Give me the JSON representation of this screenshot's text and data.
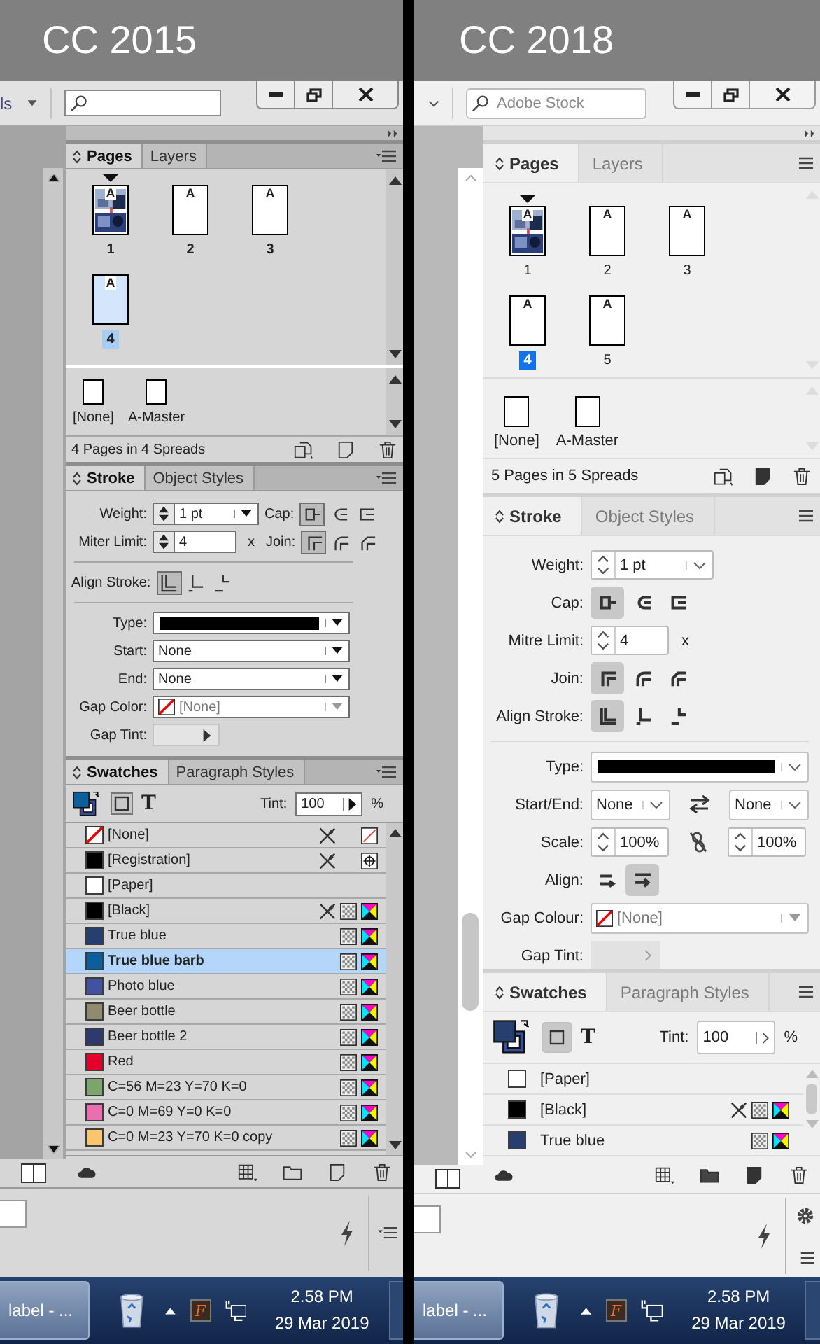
{
  "panes": [
    {
      "kind": "dark",
      "heading": "CC 2015",
      "toolbar": {
        "menu_text": "ls"
      },
      "pages_panel": {
        "tabs": [
          {
            "label": "Pages",
            "selected": true
          },
          {
            "label": "Layers",
            "selected": false
          }
        ],
        "pages": [
          {
            "number": "1",
            "master": "A",
            "kind": "picture",
            "selected": false,
            "current": true
          },
          {
            "number": "2",
            "master": "A",
            "kind": "blank",
            "selected": false,
            "current": false
          },
          {
            "number": "3",
            "master": "A",
            "kind": "blank",
            "selected": false,
            "current": false
          },
          {
            "number": "4",
            "master": "A",
            "kind": "blank",
            "selected": true,
            "current": false
          }
        ],
        "masters": [
          "[None]",
          "A-Master"
        ],
        "status": "4 Pages in 4 Spreads"
      },
      "stroke_panel": {
        "tabs": [
          {
            "label": "Stroke",
            "selected": true
          },
          {
            "label": "Object Styles",
            "selected": false
          }
        ],
        "rows": [
          {
            "items": [
              {
                "kind": "label",
                "text": "Weight:"
              },
              {
                "kind": "stepper",
                "value": "1 pt",
                "dropdown": true
              },
              {
                "kind": "label",
                "text": "Cap:"
              },
              {
                "kind": "cap-buttons",
                "buttons": [
                  {
                    "selected": true
                  },
                  {
                    "selected": false
                  },
                  {
                    "selected": false
                  }
                ]
              }
            ]
          },
          {
            "items": [
              {
                "kind": "label",
                "text": "Miter Limit:"
              },
              {
                "kind": "stepper",
                "value": "4",
                "dropdown": false
              },
              {
                "kind": "suffix",
                "text": "x"
              },
              {
                "kind": "label",
                "text": "Join:"
              },
              {
                "kind": "join-buttons",
                "buttons": [
                  {
                    "selected": true
                  },
                  {
                    "selected": false
                  },
                  {
                    "selected": false
                  }
                ]
              }
            ]
          },
          {
            "kind": "divider"
          },
          {
            "items": [
              {
                "kind": "label",
                "text": "Align Stroke:"
              },
              {
                "kind": "align-buttons",
                "buttons": [
                  {
                    "selected": true
                  },
                  {
                    "selected": false
                  },
                  {
                    "selected": false
                  }
                ]
              }
            ]
          },
          {
            "kind": "divider"
          },
          {
            "items": [
              {
                "kind": "label",
                "text": "Type:"
              },
              {
                "kind": "line-dropdown"
              }
            ]
          },
          {
            "items": [
              {
                "kind": "label",
                "text": "Start:"
              },
              {
                "kind": "dropdown",
                "value": "None"
              }
            ]
          },
          {
            "items": [
              {
                "kind": "label",
                "text": "End:"
              },
              {
                "kind": "dropdown",
                "value": "None"
              }
            ]
          },
          {
            "items": [
              {
                "kind": "label",
                "text": "Gap Color:"
              },
              {
                "kind": "swatch-dropdown",
                "value": "[None]",
                "disabled": true
              }
            ]
          },
          {
            "items": [
              {
                "kind": "label",
                "text": "Gap Tint:"
              },
              {
                "kind": "tint-field",
                "disabled": true
              }
            ]
          }
        ]
      },
      "swatches_panel": {
        "tabs": [
          {
            "label": "Swatches",
            "selected": true
          },
          {
            "label": "Paragraph Styles",
            "selected": false
          }
        ],
        "text_toggle": "T",
        "tint_label": "Tint:",
        "tint": "100",
        "tint_unit": "%",
        "swatches": [
          {
            "name": "[None]",
            "kind": "none",
            "editable": false,
            "selected": false
          },
          {
            "name": "[Registration]",
            "kind": "registration",
            "color": "#000000",
            "editable": false,
            "selected": false
          },
          {
            "name": "[Paper]",
            "kind": "paper",
            "color": "#ffffff",
            "editable": true,
            "selected": false
          },
          {
            "name": "[Black]",
            "kind": "black",
            "color": "#000000",
            "editable": false,
            "selected": false
          },
          {
            "name": "True blue",
            "kind": "process",
            "color": "#263f6e",
            "editable": true,
            "selected": false
          },
          {
            "name": "True blue barb",
            "kind": "process",
            "color": "#0a5f9c",
            "editable": true,
            "selected": true
          },
          {
            "name": "Photo blue",
            "kind": "process",
            "color": "#4252a0",
            "editable": true,
            "selected": false
          },
          {
            "name": "Beer bottle",
            "kind": "process",
            "color": "#8f8a70",
            "editable": true,
            "selected": false
          },
          {
            "name": "Beer bottle 2",
            "kind": "process",
            "color": "#2e3a6e",
            "editable": true,
            "selected": false
          },
          {
            "name": "Red",
            "kind": "process",
            "color": "#e4002b",
            "editable": true,
            "selected": false
          },
          {
            "name": "C=56 M=23 Y=70 K=0",
            "kind": "process",
            "color": "#7fa56e",
            "editable": true,
            "selected": false
          },
          {
            "name": "C=0 M=69 Y=0 K=0",
            "kind": "process",
            "color": "#ea6eb0",
            "editable": true,
            "selected": false
          },
          {
            "name": "C=0 M=23 Y=70 K=0 copy",
            "kind": "process",
            "color": "#fbc46e",
            "editable": true,
            "selected": false
          }
        ]
      },
      "taskbar": {
        "window_button": "label - ...",
        "app_icon_letter": "F",
        "time": "2.58 PM",
        "date": "29 Mar 2019"
      }
    },
    {
      "kind": "light",
      "heading": "CC 2018",
      "toolbar": {
        "search_placeholder": "Adobe Stock"
      },
      "pages_panel": {
        "tabs": [
          {
            "label": "Pages",
            "selected": true
          },
          {
            "label": "Layers",
            "selected": false
          }
        ],
        "pages": [
          {
            "number": "1",
            "master": "A",
            "kind": "picture",
            "selected": false,
            "current": true
          },
          {
            "number": "2",
            "master": "A",
            "kind": "blank",
            "selected": false,
            "current": false
          },
          {
            "number": "3",
            "master": "A",
            "kind": "blank",
            "selected": false,
            "current": false
          },
          {
            "number": "4",
            "master": "A",
            "kind": "blank",
            "selected": true,
            "current": false
          },
          {
            "number": "5",
            "master": "A",
            "kind": "blank",
            "selected": false,
            "current": false
          }
        ],
        "masters": [
          "[None]",
          "A-Master"
        ],
        "status": "5 Pages in 5 Spreads"
      },
      "stroke_panel": {
        "tabs": [
          {
            "label": "Stroke",
            "selected": true
          },
          {
            "label": "Object Styles",
            "selected": false
          }
        ],
        "rows": [
          {
            "items": [
              {
                "kind": "label",
                "text": "Weight:"
              },
              {
                "kind": "stepper",
                "value": "1 pt",
                "dropdown": true
              }
            ]
          },
          {
            "items": [
              {
                "kind": "label",
                "text": "Cap:"
              },
              {
                "kind": "cap-buttons",
                "buttons": [
                  {
                    "selected": true
                  },
                  {
                    "selected": false
                  },
                  {
                    "selected": false
                  }
                ]
              }
            ]
          },
          {
            "items": [
              {
                "kind": "label",
                "text": "Mitre Limit:"
              },
              {
                "kind": "stepper",
                "value": "4",
                "dropdown": false
              },
              {
                "kind": "suffix",
                "text": "x"
              }
            ]
          },
          {
            "items": [
              {
                "kind": "label",
                "text": "Join:"
              },
              {
                "kind": "join-buttons",
                "buttons": [
                  {
                    "selected": true
                  },
                  {
                    "selected": false
                  },
                  {
                    "selected": false
                  }
                ]
              }
            ]
          },
          {
            "items": [
              {
                "kind": "label",
                "text": "Align Stroke:"
              },
              {
                "kind": "align-buttons",
                "buttons": [
                  {
                    "selected": true
                  },
                  {
                    "selected": false
                  },
                  {
                    "selected": false
                  }
                ]
              }
            ]
          },
          {
            "kind": "divider"
          },
          {
            "items": [
              {
                "kind": "label",
                "text": "Type:"
              },
              {
                "kind": "line-dropdown"
              }
            ]
          },
          {
            "items": [
              {
                "kind": "label",
                "text": "Start/End:"
              },
              {
                "kind": "dropdown",
                "value": "None"
              },
              {
                "kind": "swap-icon"
              },
              {
                "kind": "dropdown",
                "value": "None"
              }
            ]
          },
          {
            "items": [
              {
                "kind": "label",
                "text": "Scale:"
              },
              {
                "kind": "stepper",
                "value": "100%",
                "dropdown": false
              },
              {
                "kind": "link-icon"
              },
              {
                "kind": "stepper",
                "value": "100%",
                "dropdown": false
              }
            ]
          },
          {
            "items": [
              {
                "kind": "label",
                "text": "Align:"
              },
              {
                "kind": "direction-buttons",
                "buttons": [
                  {
                    "selected": false
                  },
                  {
                    "selected": true
                  }
                ]
              }
            ]
          },
          {
            "items": [
              {
                "kind": "label",
                "text": "Gap Colour:"
              },
              {
                "kind": "swatch-dropdown",
                "value": "[None]",
                "disabled": true
              }
            ]
          },
          {
            "items": [
              {
                "kind": "label",
                "text": "Gap Tint:"
              },
              {
                "kind": "tint-field",
                "disabled": true
              }
            ]
          }
        ]
      },
      "swatches_panel": {
        "tabs": [
          {
            "label": "Swatches",
            "selected": true
          },
          {
            "label": "Paragraph Styles",
            "selected": false
          }
        ],
        "text_toggle": "T",
        "tint_label": "Tint:",
        "tint": "100",
        "tint_unit": "%",
        "swatches": [
          {
            "name": "[Paper]",
            "kind": "paper",
            "color": "#ffffff",
            "editable": true,
            "selected": false
          },
          {
            "name": "[Black]",
            "kind": "black",
            "color": "#000000",
            "editable": false,
            "selected": false
          },
          {
            "name": "True blue",
            "kind": "process",
            "color": "#263f6e",
            "editable": true,
            "selected": false
          }
        ]
      },
      "taskbar": {
        "window_button": "label - ...",
        "app_icon_letter": "F",
        "time": "2.58 PM",
        "date": "29 Mar 2019"
      }
    }
  ]
}
